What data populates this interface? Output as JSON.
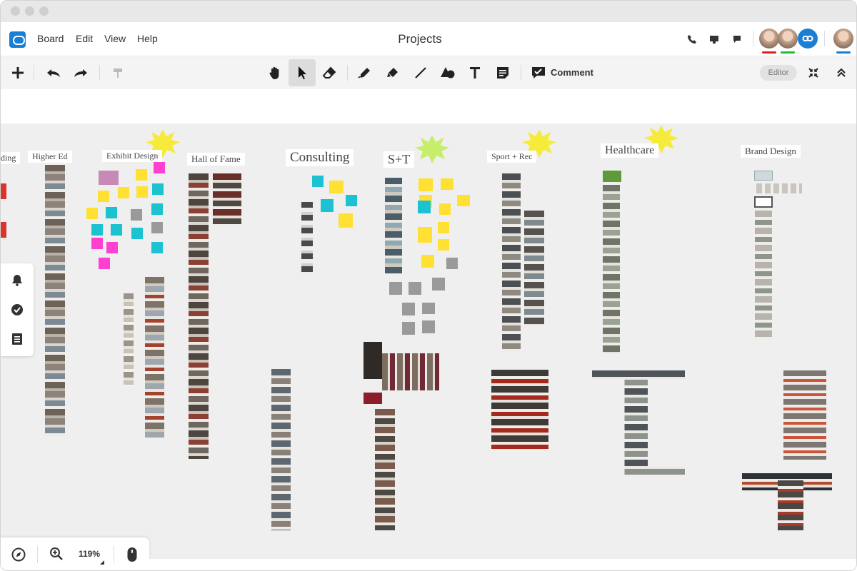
{
  "window": {
    "title": "Projects"
  },
  "menu": {
    "items": [
      "Board",
      "Edit",
      "View",
      "Help"
    ]
  },
  "header_icons": [
    "phone-icon",
    "screen-share-icon",
    "chat-icon"
  ],
  "collaborators": [
    {
      "color": "#e02020"
    },
    {
      "color": "#22bb33"
    },
    {
      "link": "link-icon"
    },
    {
      "color": "#1a7fd4"
    }
  ],
  "toolbar": {
    "comment_label": "Comment",
    "role_badge": "Editor"
  },
  "zoom": {
    "level": "119%"
  },
  "board": {
    "columns": [
      "ding",
      "Higher Ed",
      "Exhibit Design",
      "Hall of Fame",
      "Consulting",
      "S+T",
      "Sport + Rec",
      "Healthcare",
      "Brand Design"
    ]
  },
  "colors": {
    "accent": "#1a7fd4",
    "sticky_yellow": "#ffe033",
    "sticky_cyan": "#1dc2d1",
    "sticky_magenta": "#ff3fd2",
    "sticky_gray": "#9a9a9a",
    "star_yellow": "#f6ea3a",
    "star_green": "#c6ee6a"
  }
}
